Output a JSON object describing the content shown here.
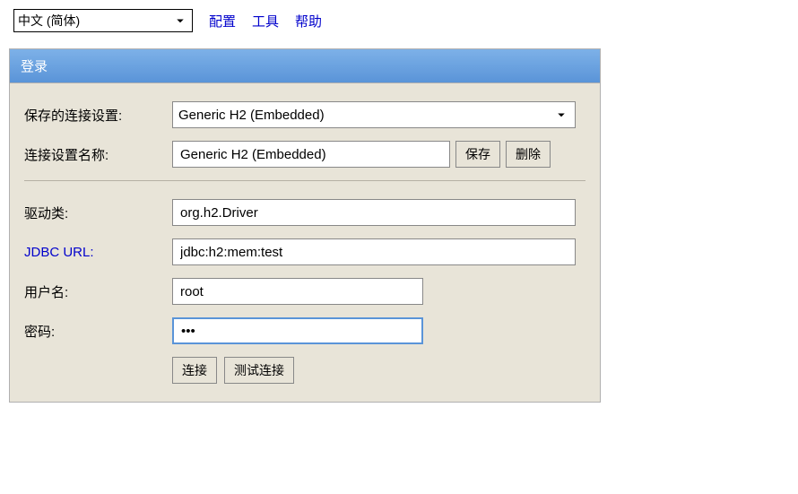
{
  "topbar": {
    "language": "中文 (简体)",
    "links": {
      "config": "配置",
      "tools": "工具",
      "help": "帮助"
    }
  },
  "panel": {
    "title": "登录"
  },
  "form": {
    "saved_settings_label": "保存的连接设置:",
    "saved_settings_value": "Generic H2 (Embedded)",
    "setting_name_label": "连接设置名称:",
    "setting_name_value": "Generic H2 (Embedded)",
    "save_btn": "保存",
    "delete_btn": "删除",
    "driver_label": "驱动类:",
    "driver_value": "org.h2.Driver",
    "jdbc_label": "JDBC URL:",
    "jdbc_value": "jdbc:h2:mem:test",
    "user_label": "用户名:",
    "user_value": "root",
    "password_label": "密码:",
    "password_value": "•••",
    "connect_btn": "连接",
    "test_btn": "测试连接"
  }
}
